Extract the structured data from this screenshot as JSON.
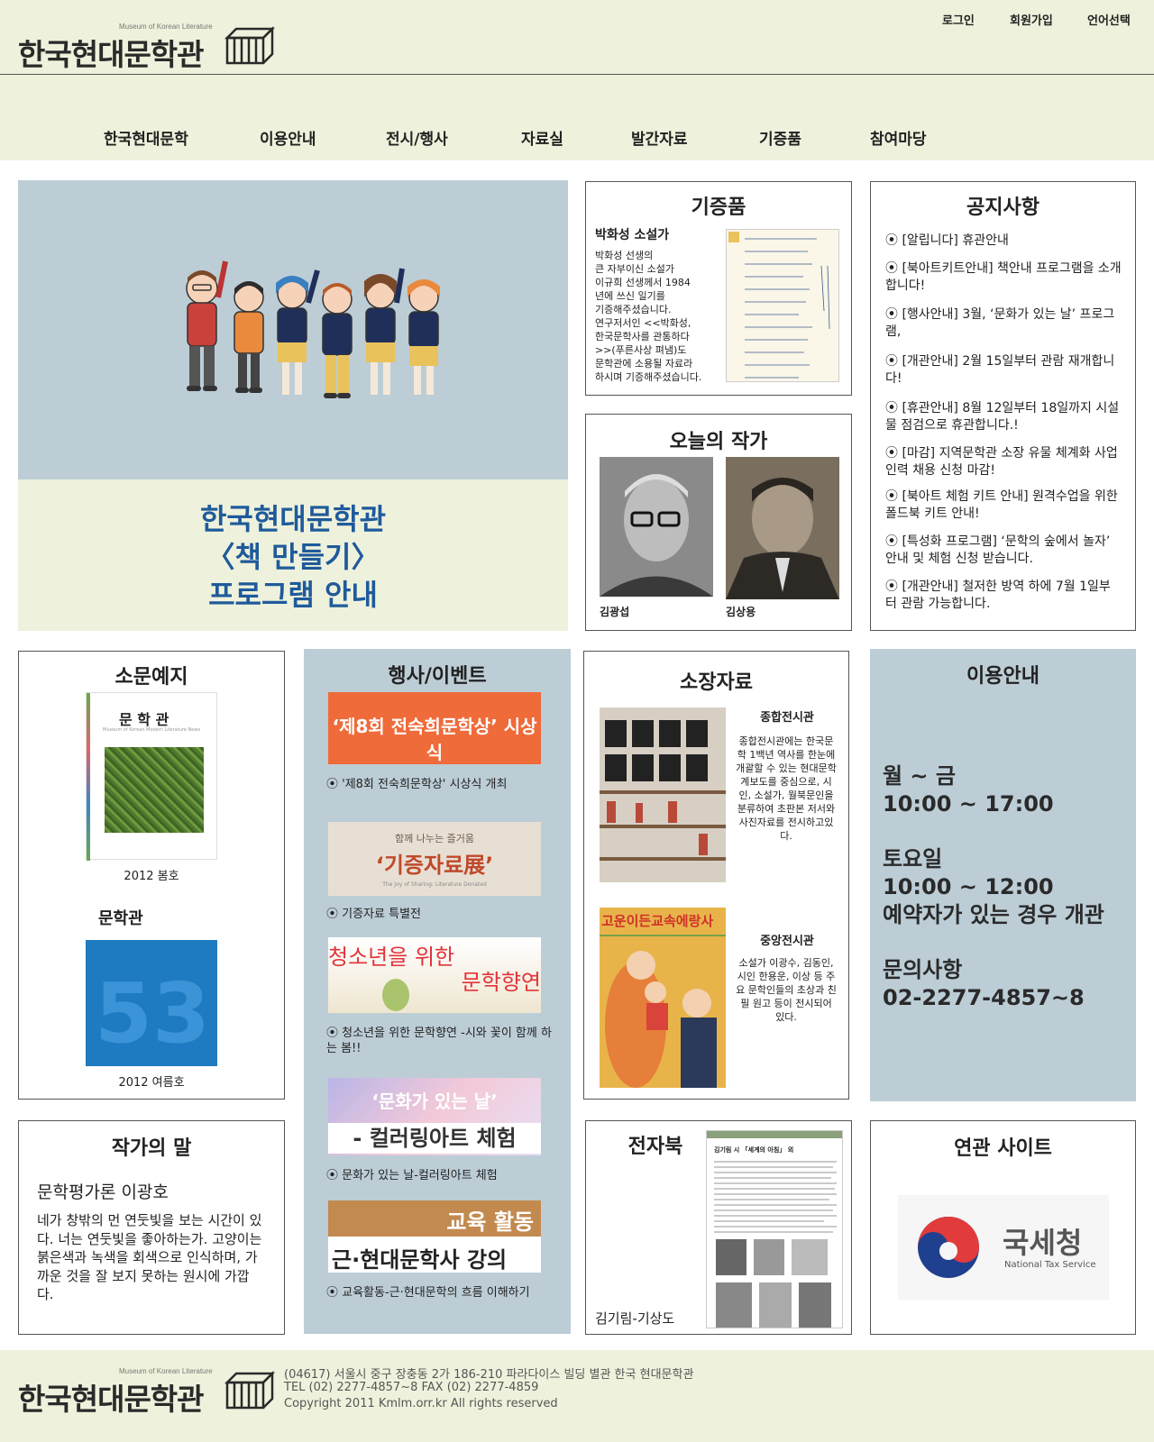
{
  "header": {
    "logo_sub": "Museum of Korean Literature",
    "logo_text": "한국현대문학관",
    "util": {
      "login": "로그인",
      "signup": "회원가입",
      "language": "언어선택"
    },
    "nav": [
      "한국현대문학",
      "이용안내",
      "전시/행사",
      "자료실",
      "발간자료",
      "기증품",
      "참여마당"
    ]
  },
  "banner": {
    "line1": "한국현대문학관",
    "line2": "〈책 만들기〉",
    "line3": "프로그램 안내"
  },
  "donation": {
    "title": "기증품",
    "heading": "박화성 소설가",
    "body": [
      "박화성 선생의",
      "큰 자부이신 소설가",
      "이규희 선생께서 1984",
      "년에 쓰신 일기를",
      "기증해주셨습니다.",
      "연구저서인 <<박화성,",
      "한국문학사를 관통하다",
      ">>(푸른사상 펴냄)도",
      "문학관에 소용될 자료라",
      "하시며 기증해주셨습니다."
    ]
  },
  "author_today": {
    "title": "오늘의 작가",
    "names": [
      "김광섭",
      "김상용"
    ]
  },
  "notices": {
    "title": "공지사항",
    "items": [
      "⦿ [알립니다] 휴관안내",
      "⦿ [북아트키트안내] 책안내 프로그램을 소개합니다!",
      "⦿ [행사안내] 3월, ‘문화가 있는 날’ 프로그램,",
      "⦿ [개관안내] 2월 15일부터 관람 재개합니다!",
      "⦿ [휴관안내] 8월 12일부터 18일까지 시설물 점검으로 휴관합니다.!",
      "⦿ [마감] 지역문학관 소장 유물 체계화 사업 인력 채용 신청 마감!",
      "⦿ [북아트 체험 키트 안내] 원격수업을 위한 폴드북 키트 안내!",
      "⦿ [특성화 프로그램] ‘문학의 숲에서 놀자’ 안내 및 체험 신청 받습니다.",
      "⦿ [개관안내] 철저한 방역 하에 7월 1일부터 관람 가능합니다."
    ]
  },
  "newsletter": {
    "title": "소문예지",
    "cover1_title": "문 학 관",
    "cover1_sub": "Museum of Korean Modern Literature News",
    "cover1_caption": "2012 봄호",
    "cover2_title": "문학관",
    "cover2_num": "53",
    "cover2_caption": "2012 여름호"
  },
  "events": {
    "title": "행사/이벤트",
    "items": [
      {
        "thumb": "‘제8회 전숙희문학상’ 시상식",
        "caption": "⦿ '제8회 전숙희문학상' 시상식 개최"
      },
      {
        "thumb_top": "함께 나누는 즐거움",
        "thumb": "‘기증자료展’",
        "thumb_bottom": "The Joy of Sharing: Literature Donated",
        "caption": "⦿ 기증자료 특별전"
      },
      {
        "thumb": "청소년을 위한",
        "thumb2": "문학향연",
        "caption": "⦿ 청소년을 위한 문학향연 -시와 꽃이 함께 하는 봄!!"
      },
      {
        "thumb": "‘문화가 있는 날’",
        "thumb2": "- 컬러링아트 체험",
        "caption": "⦿ 문화가 있는 날-컬러링아트 체험"
      },
      {
        "thumb": "교육 활동",
        "thumb2": "근·현대문학사 강의",
        "caption": "⦿ 교육활동-근·현대문학의 흐름 이해하기"
      }
    ]
  },
  "collection": {
    "title": "소장자료",
    "hall1": {
      "name": "종합전시관",
      "desc": "종합전시관에는 한국문학 1백년 역사를 한눈에 개괄할 수 있는 현대문학 계보도를 중심으로, 시인, 소설가, 월북문인을 분류하여 초판본 저서와 사진자료를 전시하고있다."
    },
    "hall2": {
      "name": "중앙전시관",
      "desc": "소설가 이광수, 김동인, 시인 한용운, 이상 등 주요 문학인들의 초상과 친필 원고 등이 전시되어 있다."
    },
    "poster_text": "고운이든교속에랑사"
  },
  "usage": {
    "title": "이용안내",
    "weekday": "월 ~ 금",
    "weekday_hours": "10:00 ~ 17:00",
    "saturday": "토요일",
    "saturday_hours": "10:00 ~ 12:00",
    "saturday_note": "예약자가 있는 경우 개관",
    "contact": "문의사항",
    "phone": "02-2277-4857~8"
  },
  "author_words": {
    "title": "작가의 말",
    "author": "문학평가론 이광호",
    "text": "네가 창밖의 먼 연둣빛을 보는 시간이 있다. 너는 연둣빛을 좋아하는가. 고양이는 붉은색과 녹색을 회색으로 인식하며, 가까운 것을 잘 보지 못하는 원시에 가깝다."
  },
  "ebook": {
    "title": "전자북",
    "caption": "김기림-기상도",
    "page_heading": "김기림 시 「세계의 아침」 외"
  },
  "related": {
    "title": "연관 사이트",
    "nts_name": "국세청",
    "nts_en": "National Tax Service"
  },
  "footer": {
    "logo_sub": "Museum of Korean Literature",
    "logo_text": "한국현대문학관",
    "address": "(04617) 서울시 중구 장충동 2가 186-210 파라다이스 빌딩 별관 한국 현대문학관",
    "contact": "TEL (02) 2277-4857~8 FAX (02) 2277-4859",
    "copyright": "Copyright 2011 Kmlm.orr.kr All rights reserved"
  },
  "colors": {
    "cream": "#eef2dc",
    "steel": "#bccdd6",
    "banner_text": "#1f5a9b"
  }
}
